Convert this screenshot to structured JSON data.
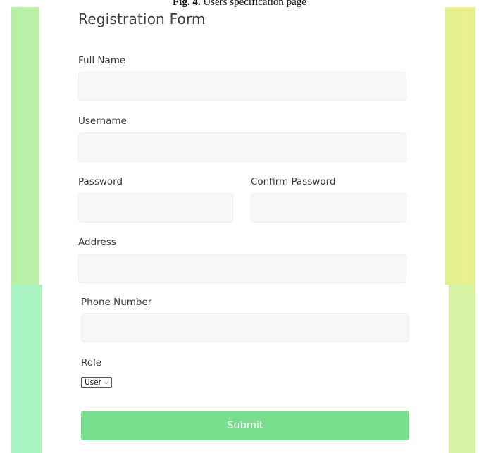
{
  "caption": {
    "fig": "Fig. 4.",
    "text": "Users specification page"
  },
  "form": {
    "title": "Registration Form",
    "full_name_label": "Full Name",
    "username_label": "Username",
    "password_label": "Password",
    "confirm_password_label": "Confirm Password",
    "address_label": "Address",
    "phone_label": "Phone Number",
    "role_label": "Role",
    "role_selected": "User",
    "submit_label": "Submit"
  },
  "colors": {
    "submit_bg": "#79df8e",
    "field_bg": "#f7f7f7",
    "gradient_left": "#b6f0a7",
    "gradient_right": "#e9f08e"
  },
  "icons": {
    "select_arrow": "chevron-down-icon"
  }
}
